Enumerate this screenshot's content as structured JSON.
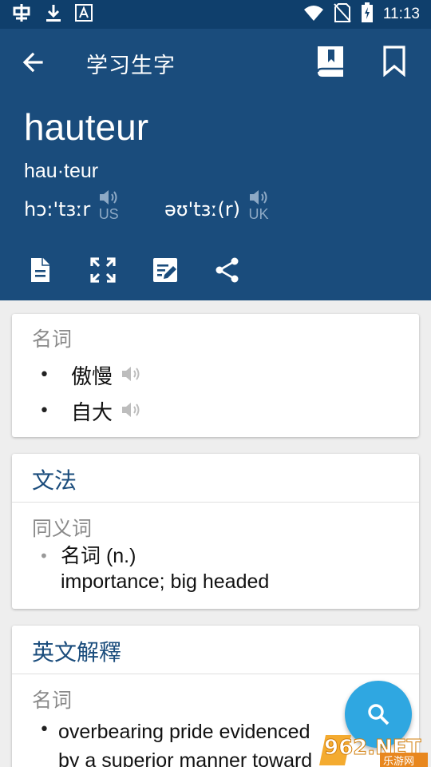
{
  "status_bar": {
    "time": "11:13",
    "left_icons": [
      "app-notification-icon",
      "download-icon",
      "font-app-icon"
    ],
    "right_icons": [
      "wifi-icon",
      "no-sim-icon",
      "battery-charging-icon"
    ]
  },
  "app_bar": {
    "title": "学习生字",
    "icons": [
      "back-arrow-icon",
      "wordbook-icon",
      "bookmark-icon"
    ]
  },
  "entry": {
    "word": "hauteur",
    "syllables": "hau·teur",
    "pronunciations": [
      {
        "ipa": "hɔ:'tɜːr",
        "label": "US"
      },
      {
        "ipa": "əʊ'tɜː(r)",
        "label": "UK"
      }
    ],
    "tool_icons": [
      "document-icon",
      "fullscreen-icon",
      "edit-note-icon",
      "share-icon"
    ]
  },
  "meanings_card": {
    "pos": "名词",
    "senses": [
      "傲慢",
      "自大"
    ]
  },
  "grammar_card": {
    "title": "文法",
    "section": "同义词",
    "item_pos": "名词 (n.)",
    "item_text": "importance; big headed"
  },
  "english_card": {
    "title": "英文解釋",
    "pos": "名词",
    "definition_line1": "overbearing pride evidenced",
    "definition_line2": "by a superior manner toward"
  },
  "fab": {
    "icon": "search-icon"
  },
  "watermark": {
    "text": "962.NET",
    "subtext": "乐游网"
  },
  "colors": {
    "status_bar": "#0f3f6c",
    "header": "#1a4c7c",
    "accent_title": "#1a4c7c",
    "fab": "#2fa7e1",
    "background": "#eeeeee"
  }
}
